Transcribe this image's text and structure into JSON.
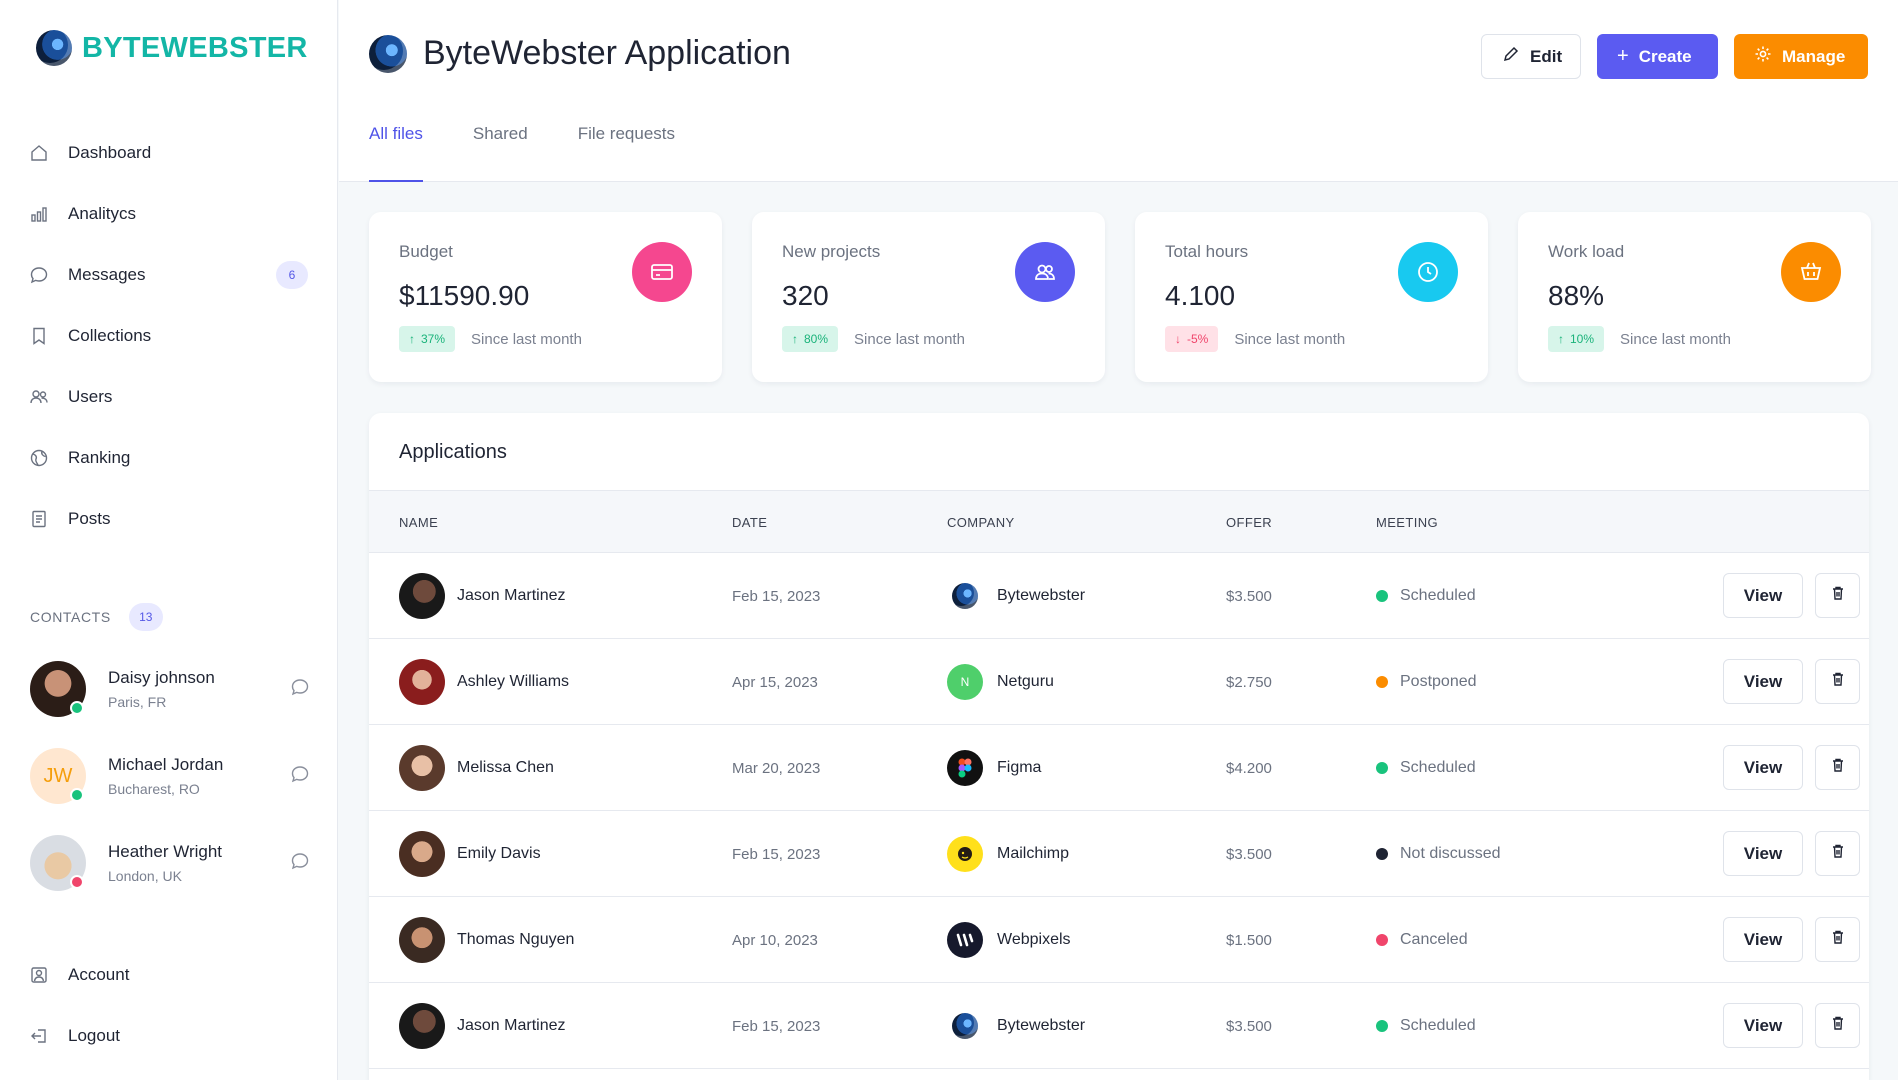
{
  "brand": {
    "name": "BYTEWEBSTER"
  },
  "sidebar": {
    "items": [
      {
        "label": "Dashboard",
        "icon": "home-icon"
      },
      {
        "label": "Analitycs",
        "icon": "bar-chart-icon"
      },
      {
        "label": "Messages",
        "icon": "chat-icon",
        "badge": "6"
      },
      {
        "label": "Collections",
        "icon": "bookmark-icon"
      },
      {
        "label": "Users",
        "icon": "users-icon"
      },
      {
        "label": "Ranking",
        "icon": "globe-icon"
      },
      {
        "label": "Posts",
        "icon": "document-icon"
      }
    ],
    "contacts_title": "CONTACTS",
    "contacts_count": "13",
    "contacts": [
      {
        "name": "Daisy johnson",
        "location": "Paris, FR",
        "status_color": "#19c37d"
      },
      {
        "name": "Michael Jordan",
        "location": "Bucharest, RO",
        "initials": "JW",
        "status_color": "#19c37d"
      },
      {
        "name": "Heather Wright",
        "location": "London, UK",
        "status_color": "#f0456b"
      }
    ],
    "bottom": [
      {
        "label": "Account",
        "icon": "user-icon"
      },
      {
        "label": "Logout",
        "icon": "logout-icon"
      }
    ]
  },
  "header": {
    "title": "ByteWebster Application",
    "edit_label": "Edit",
    "create_label": "Create",
    "manage_label": "Manage",
    "tabs": [
      {
        "label": "All files"
      },
      {
        "label": "Shared"
      },
      {
        "label": "File requests"
      }
    ]
  },
  "stats": [
    {
      "title": "Budget",
      "value": "$11590.90",
      "change": "37%",
      "direction": "up",
      "since": "Since last month",
      "color": "#f5478f",
      "icon": "credit-card-icon"
    },
    {
      "title": "New projects",
      "value": "320",
      "change": "80%",
      "direction": "up",
      "since": "Since last month",
      "color": "#5b5bf1",
      "icon": "people-icon"
    },
    {
      "title": "Total hours",
      "value": "4.100",
      "change": "-5%",
      "direction": "down",
      "since": "Since last month",
      "color": "#18c9f0",
      "icon": "clock-icon"
    },
    {
      "title": "Work load",
      "value": "88%",
      "change": "10%",
      "direction": "up",
      "since": "Since last month",
      "color": "#fb8c00",
      "icon": "cart-icon"
    }
  ],
  "applications": {
    "title": "Applications",
    "columns": [
      "NAME",
      "DATE",
      "COMPANY",
      "OFFER",
      "MEETING"
    ],
    "view_label": "View",
    "rows": [
      {
        "name": "Jason Martinez",
        "date": "Feb 15, 2023",
        "company": "Bytewebster",
        "offer": "$3.500",
        "meeting": "Scheduled",
        "meeting_color": "#19c37d"
      },
      {
        "name": "Ashley Williams",
        "date": "Apr 15, 2023",
        "company": "Netguru",
        "offer": "$2.750",
        "meeting": "Postponed",
        "meeting_color": "#fb8c00"
      },
      {
        "name": "Melissa Chen",
        "date": "Mar 20, 2023",
        "company": "Figma",
        "offer": "$4.200",
        "meeting": "Scheduled",
        "meeting_color": "#19c37d"
      },
      {
        "name": "Emily Davis",
        "date": "Feb 15, 2023",
        "company": "Mailchimp",
        "offer": "$3.500",
        "meeting": "Not discussed",
        "meeting_color": "#1f2433"
      },
      {
        "name": "Thomas Nguyen",
        "date": "Apr 10, 2023",
        "company": "Webpixels",
        "offer": "$1.500",
        "meeting": "Canceled",
        "meeting_color": "#f0456b"
      },
      {
        "name": "Jason Martinez",
        "date": "Feb 15, 2023",
        "company": "Bytewebster",
        "offer": "$3.500",
        "meeting": "Scheduled",
        "meeting_color": "#19c37d"
      }
    ]
  }
}
